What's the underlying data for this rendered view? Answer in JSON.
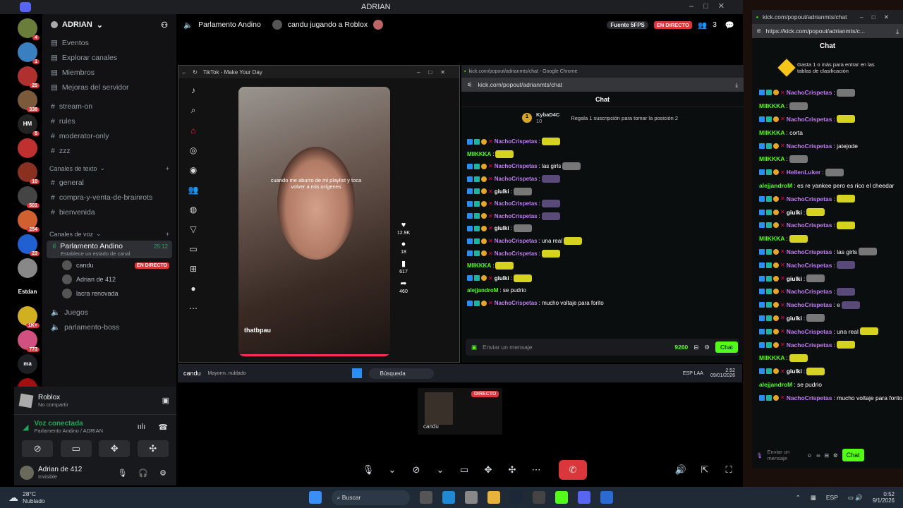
{
  "window": {
    "title": "ADRIAN"
  },
  "servers": [
    {
      "badge": "4",
      "color": "#6b7d3a"
    },
    {
      "badge": "1",
      "color": "#3a7fbf"
    },
    {
      "badge": "25",
      "color": "#b03030"
    },
    {
      "badge": "338",
      "color": "#7a5a3a"
    },
    {
      "label": "HM",
      "badge": "5",
      "color": "#222"
    },
    {
      "badge": "",
      "color": "#c03030"
    },
    {
      "badge": "10",
      "color": "#8a3020"
    },
    {
      "badge": "501",
      "color": "#444"
    },
    {
      "badge": "254",
      "color": "#d06030"
    },
    {
      "badge": "23",
      "color": "#2060d0"
    },
    {
      "badge": "",
      "color": "#888"
    },
    {
      "label": "Estdan",
      "badge": "",
      "color": "#000"
    },
    {
      "badge": "1K+",
      "color": "#d0b020"
    },
    {
      "badge": "773",
      "color": "#d05080"
    },
    {
      "label": "ma",
      "badge": "",
      "color": "#1e1f22"
    },
    {
      "badge": "",
      "color": "#a01010"
    }
  ],
  "server": {
    "name": "ADRIAN"
  },
  "menu": [
    "Eventos",
    "Explorar canales",
    "Miembros",
    "Mejoras del servidor"
  ],
  "text_top": [
    "stream-on",
    "rules",
    "moderator-only",
    "zzz"
  ],
  "cat_text": "Canales de texto",
  "text_channels": [
    "general",
    "compra-y-venta-de-brainrots",
    "bienvenida"
  ],
  "cat_voice": "Canales de voz",
  "voice_active": {
    "name": "Parlamento Andino",
    "time": "25:12",
    "status": "Establece un estado de canal"
  },
  "voice_users": [
    {
      "name": "candu",
      "live": "EN DIRECTO"
    },
    {
      "name": "Adrian de 412",
      "live": ""
    },
    {
      "name": "lacra renovada",
      "live": ""
    }
  ],
  "voice_other": [
    "Juegos",
    "parlamento-boss"
  ],
  "activity": {
    "name": "Roblox",
    "sub": "No compartir"
  },
  "voice_conn": {
    "title": "Voz conectada",
    "sub": "Parlamento Andino / ADRIAN"
  },
  "user": {
    "name": "Adrian de 412",
    "status": "Invisible"
  },
  "stage_header": {
    "channel": "Parlamento Andino",
    "stream": "candu jugando a Roblox",
    "fps": "Fuente 5FPS",
    "live": "EN DIRECTO",
    "count": "3"
  },
  "tiktok": {
    "title": "TikTok - Make Your Day",
    "caption": "cuando me aburro de mi playlist y toca volver a mis orígenes",
    "user": "thatbpau",
    "likes": "12.9K",
    "comments": "18",
    "saves": "617",
    "shares": "460"
  },
  "kick1": {
    "titlebar": "kick.com/popout/adrianmts/chat - Google Chrome",
    "url": "kick.com/popout/adrianmts/chat",
    "chat": "Chat",
    "top_user": "KybaD4C",
    "top_amount": "10",
    "gift": "Regala 1 suscripción para tomar la posición 2",
    "placeholder": "Enviar un mensaje",
    "points": "9260",
    "send": "Chat"
  },
  "kick1_msgs": [
    {
      "u": "NachoCrispetas",
      "c": "p",
      "t": ":",
      "e": "y"
    },
    {
      "u": "MIIKKKA",
      "c": "g",
      "t": ":",
      "e": "y"
    },
    {
      "u": "NachoCrispetas",
      "c": "p",
      "t": ": las girls",
      "e": "g"
    },
    {
      "u": "NachoCrispetas",
      "c": "p",
      "t": ":",
      "e": "pu"
    },
    {
      "u": "giulki",
      "c": "y",
      "t": ":",
      "e": "g"
    },
    {
      "u": "NachoCrispetas",
      "c": "p",
      "t": ":",
      "e": "pu"
    },
    {
      "u": "NachoCrispetas",
      "c": "p",
      "t": ":",
      "e": "pu"
    },
    {
      "u": "giulki",
      "c": "y",
      "t": ":",
      "e": "g"
    },
    {
      "u": "NachoCrispetas",
      "c": "p",
      "t": ": una real",
      "e": "y"
    },
    {
      "u": "NachoCrispetas",
      "c": "p",
      "t": ":",
      "e": "y"
    },
    {
      "u": "MIIKKKA",
      "c": "g",
      "t": ":",
      "e": "y"
    },
    {
      "u": "giulki",
      "c": "y",
      "t": ":",
      "e": "y"
    },
    {
      "u": "alejjandroM",
      "c": "g",
      "t": ": se pudrio",
      "e": ""
    },
    {
      "u": "NachoCrispetas",
      "c": "p",
      "t": ": mucho voltaje para forito",
      "e": ""
    }
  ],
  "inner_taskbar": {
    "user": "candu",
    "weather": "Mayorm. nublado",
    "search": "Búsqueda",
    "lang": "ESP LAA",
    "time": "2:52",
    "date": "09/01/2026"
  },
  "mini": {
    "live": "DIRECTO",
    "user": "candu"
  },
  "kick2": {
    "url": "kick.com/popout/adrianmts/chat",
    "fullurl": "https://kick.com/popout/adrianmts/c...",
    "chat": "Chat",
    "promo": "Gasta 1 o más para entrar en las tablas de clasificación",
    "placeholder": "Enviar un mensaje",
    "send": "Chat"
  },
  "kick2_msgs": [
    {
      "u": "NachoCrispetas",
      "c": "p",
      "t": ":",
      "e": "g"
    },
    {
      "u": "MIIKKKA",
      "c": "g",
      "t": ":",
      "e": "g"
    },
    {
      "u": "NachoCrispetas",
      "c": "p",
      "t": ":",
      "e": "y"
    },
    {
      "u": "MIIKKKA",
      "c": "g",
      "t": ": corta",
      "e": ""
    },
    {
      "u": "NachoCrispetas",
      "c": "p",
      "t": ": jatejode",
      "e": ""
    },
    {
      "u": "MIIKKKA",
      "c": "g",
      "t": ":",
      "e": "g"
    },
    {
      "u": "HellenLuker",
      "c": "p",
      "t": ":",
      "e": "g"
    },
    {
      "u": "alejjandroM",
      "c": "g",
      "t": ": es re yankee pero es rico el cheedar",
      "e": ""
    },
    {
      "u": "NachoCrispetas",
      "c": "p",
      "t": ":",
      "e": "y"
    },
    {
      "u": "giulki",
      "c": "y",
      "t": ":",
      "e": "y"
    },
    {
      "u": "NachoCrispetas",
      "c": "p",
      "t": ":",
      "e": "y"
    },
    {
      "u": "MIIKKKA",
      "c": "g",
      "t": ":",
      "e": "y"
    },
    {
      "u": "NachoCrispetas",
      "c": "p",
      "t": ": las girls",
      "e": "g"
    },
    {
      "u": "NachoCrispetas",
      "c": "p",
      "t": ":",
      "e": "pu"
    },
    {
      "u": "giulki",
      "c": "y",
      "t": ":",
      "e": "g"
    },
    {
      "u": "NachoCrispetas",
      "c": "p",
      "t": ":",
      "e": "pu"
    },
    {
      "u": "NachoCrispetas",
      "c": "p",
      "t": ": e",
      "e": "pu"
    },
    {
      "u": "giulki",
      "c": "y",
      "t": ":",
      "e": "g"
    },
    {
      "u": "NachoCrispetas",
      "c": "p",
      "t": ": una real",
      "e": "y"
    },
    {
      "u": "NachoCrispetas",
      "c": "p",
      "t": ":",
      "e": "y"
    },
    {
      "u": "MIIKKKA",
      "c": "g",
      "t": ":",
      "e": "y"
    },
    {
      "u": "giulki",
      "c": "y",
      "t": ":",
      "e": "y"
    },
    {
      "u": "alejjandroM",
      "c": "g",
      "t": ": se pudrio",
      "e": ""
    },
    {
      "u": "NachoCrispetas",
      "c": "p",
      "t": ": mucho voltaje para forito",
      "e": ""
    }
  ],
  "taskbar": {
    "temp": "28°C",
    "weather": "Nublado",
    "search": "Buscar",
    "lang": "ESP",
    "time": "0:52",
    "date": "9/1/2026"
  }
}
